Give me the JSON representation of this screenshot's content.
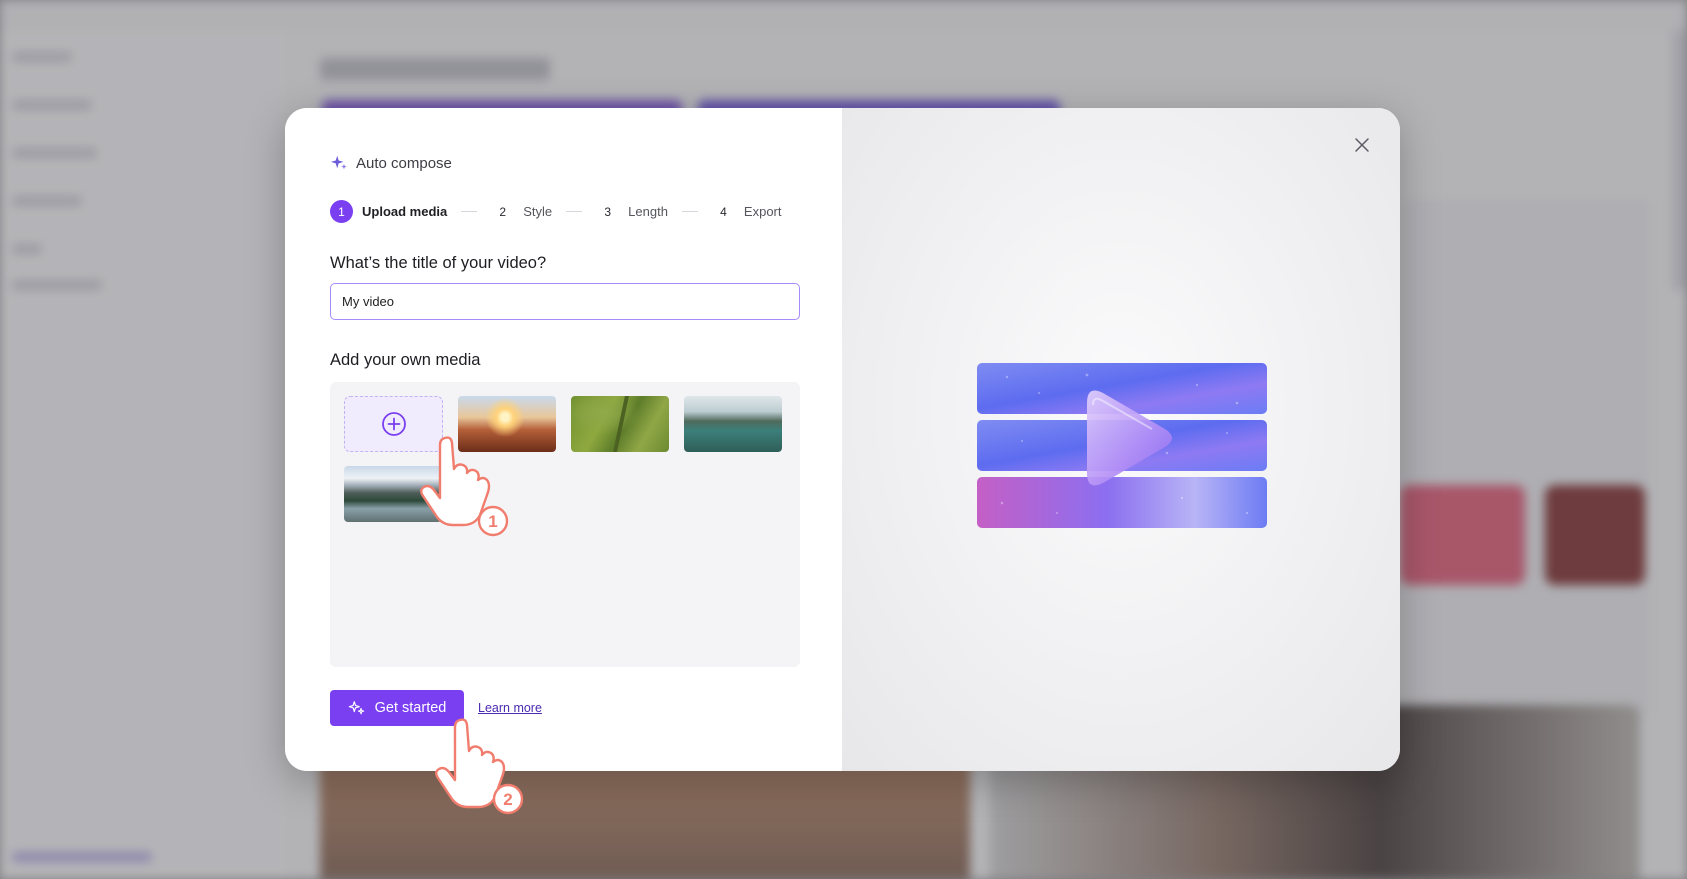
{
  "dialog": {
    "header": "Auto compose",
    "steps": [
      {
        "num": "1",
        "label": "Upload media",
        "active": true
      },
      {
        "num": "2",
        "label": "Style",
        "active": false
      },
      {
        "num": "3",
        "label": "Length",
        "active": false
      },
      {
        "num": "4",
        "label": "Export",
        "active": false
      }
    ],
    "title_question": "What’s the title of your video?",
    "title_value": "My video",
    "media_heading": "Add your own media",
    "media_items": [
      "sunset canyon",
      "green field",
      "forest lake",
      "mountain lake"
    ],
    "get_started_label": "Get started",
    "learn_more_label": "Learn more"
  },
  "callouts": {
    "hand_1": "1",
    "hand_2": "2"
  },
  "colors": {
    "accent": "#7a3ff0",
    "callout": "#f07d6e"
  },
  "icons": [
    "sparkle-icon",
    "plus-circle-icon",
    "sparkle-wand-icon",
    "close-icon",
    "pointing-hand-icon"
  ]
}
